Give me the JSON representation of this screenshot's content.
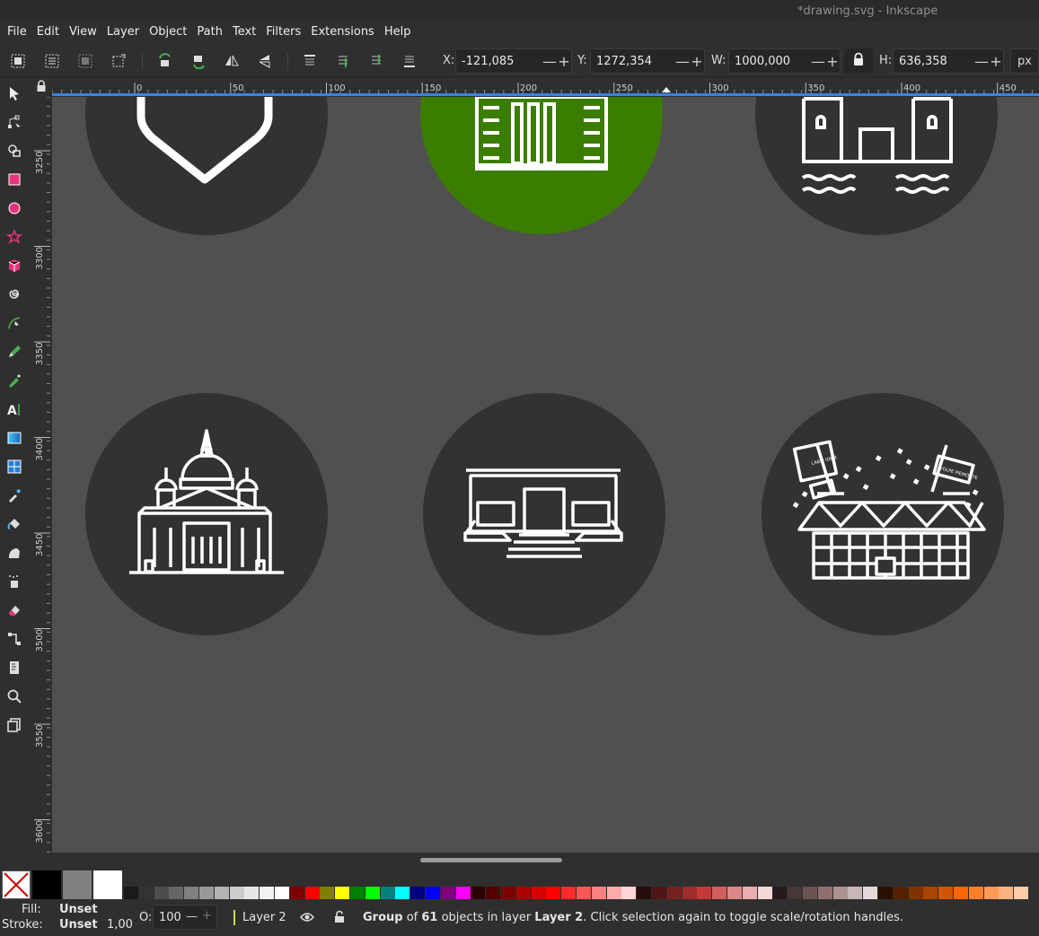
{
  "window": {
    "title": "*drawing.svg - Inkscape"
  },
  "menubar": {
    "items": [
      "File",
      "Edit",
      "View",
      "Layer",
      "Object",
      "Path",
      "Text",
      "Filters",
      "Extensions",
      "Help"
    ]
  },
  "toolbar": {
    "x_label": "X:",
    "x_value": "-121,085",
    "y_label": "Y:",
    "y_value": "1272,354",
    "w_label": "W:",
    "w_value": "1000,000",
    "h_label": "H:",
    "h_value": "636,358",
    "unit": "px",
    "minus": "—",
    "plus": "+"
  },
  "rulers": {
    "horizontal": [
      "0",
      "50",
      "100",
      "150",
      "200",
      "250",
      "300",
      "350",
      "400",
      "450"
    ],
    "vertical": [
      "3250",
      "3300",
      "3350",
      "3400",
      "3450",
      "3500",
      "3550",
      "3600"
    ]
  },
  "canvas": {
    "background": "#505050",
    "circle_color": "#323232",
    "accent_circle_color": "#3b7d00",
    "icons": [
      "heart-icon",
      "bookshelf-icon",
      "castle-icon",
      "cathedral-icon",
      "museum-icon",
      "stadium-icon"
    ]
  },
  "stadium_flags": {
    "left": "LABIS IDEM",
    "right": "VOLPE PIEMONTE"
  },
  "palette": {
    "colors": [
      "#000000",
      "#808080",
      "#ffffff",
      "#1a1a1a",
      "#333333",
      "#4d4d4d",
      "#666666",
      "#808080",
      "#999999",
      "#b3b3b3",
      "#cccccc",
      "#e6e6e6",
      "#f2f2f2",
      "#ffffff",
      "#800000",
      "#ff0000",
      "#808000",
      "#ffff00",
      "#008000",
      "#00ff00",
      "#008080",
      "#00ffff",
      "#000080",
      "#0000ff",
      "#800080",
      "#ff00ff",
      "#2b0000",
      "#550000",
      "#800000",
      "#aa0000",
      "#d40000",
      "#ff0000",
      "#ff2a2a",
      "#ff5555",
      "#ff8080",
      "#ffaaaa",
      "#ffd5d5",
      "#280b0b",
      "#501616",
      "#782121",
      "#a02c2c",
      "#c83737",
      "#d35f5f",
      "#de8787",
      "#e9afaf",
      "#f4d7d7",
      "#241c1c",
      "#483737",
      "#6c5353",
      "#916f6f",
      "#ac9393",
      "#c8b7b7",
      "#e3dbdb",
      "#2b1100",
      "#552200",
      "#803300",
      "#aa4400",
      "#d45500",
      "#ff6600",
      "#ff7f2a",
      "#ff9955",
      "#ffb380",
      "#ffccaa"
    ]
  },
  "status": {
    "fill_label": "Fill:",
    "fill_value": "Unset",
    "stroke_label": "Stroke:",
    "stroke_value": "Unset",
    "stroke_width": "1,00",
    "opacity_label": "O:",
    "opacity_value": "100",
    "layer": "Layer 2",
    "msg_group": "Group",
    "msg_of": " of ",
    "msg_count": "61",
    "msg_objects": " objects in layer ",
    "msg_layer": "Layer 2",
    "msg_rest": ". Click selection again to toggle scale/rotation handles."
  }
}
